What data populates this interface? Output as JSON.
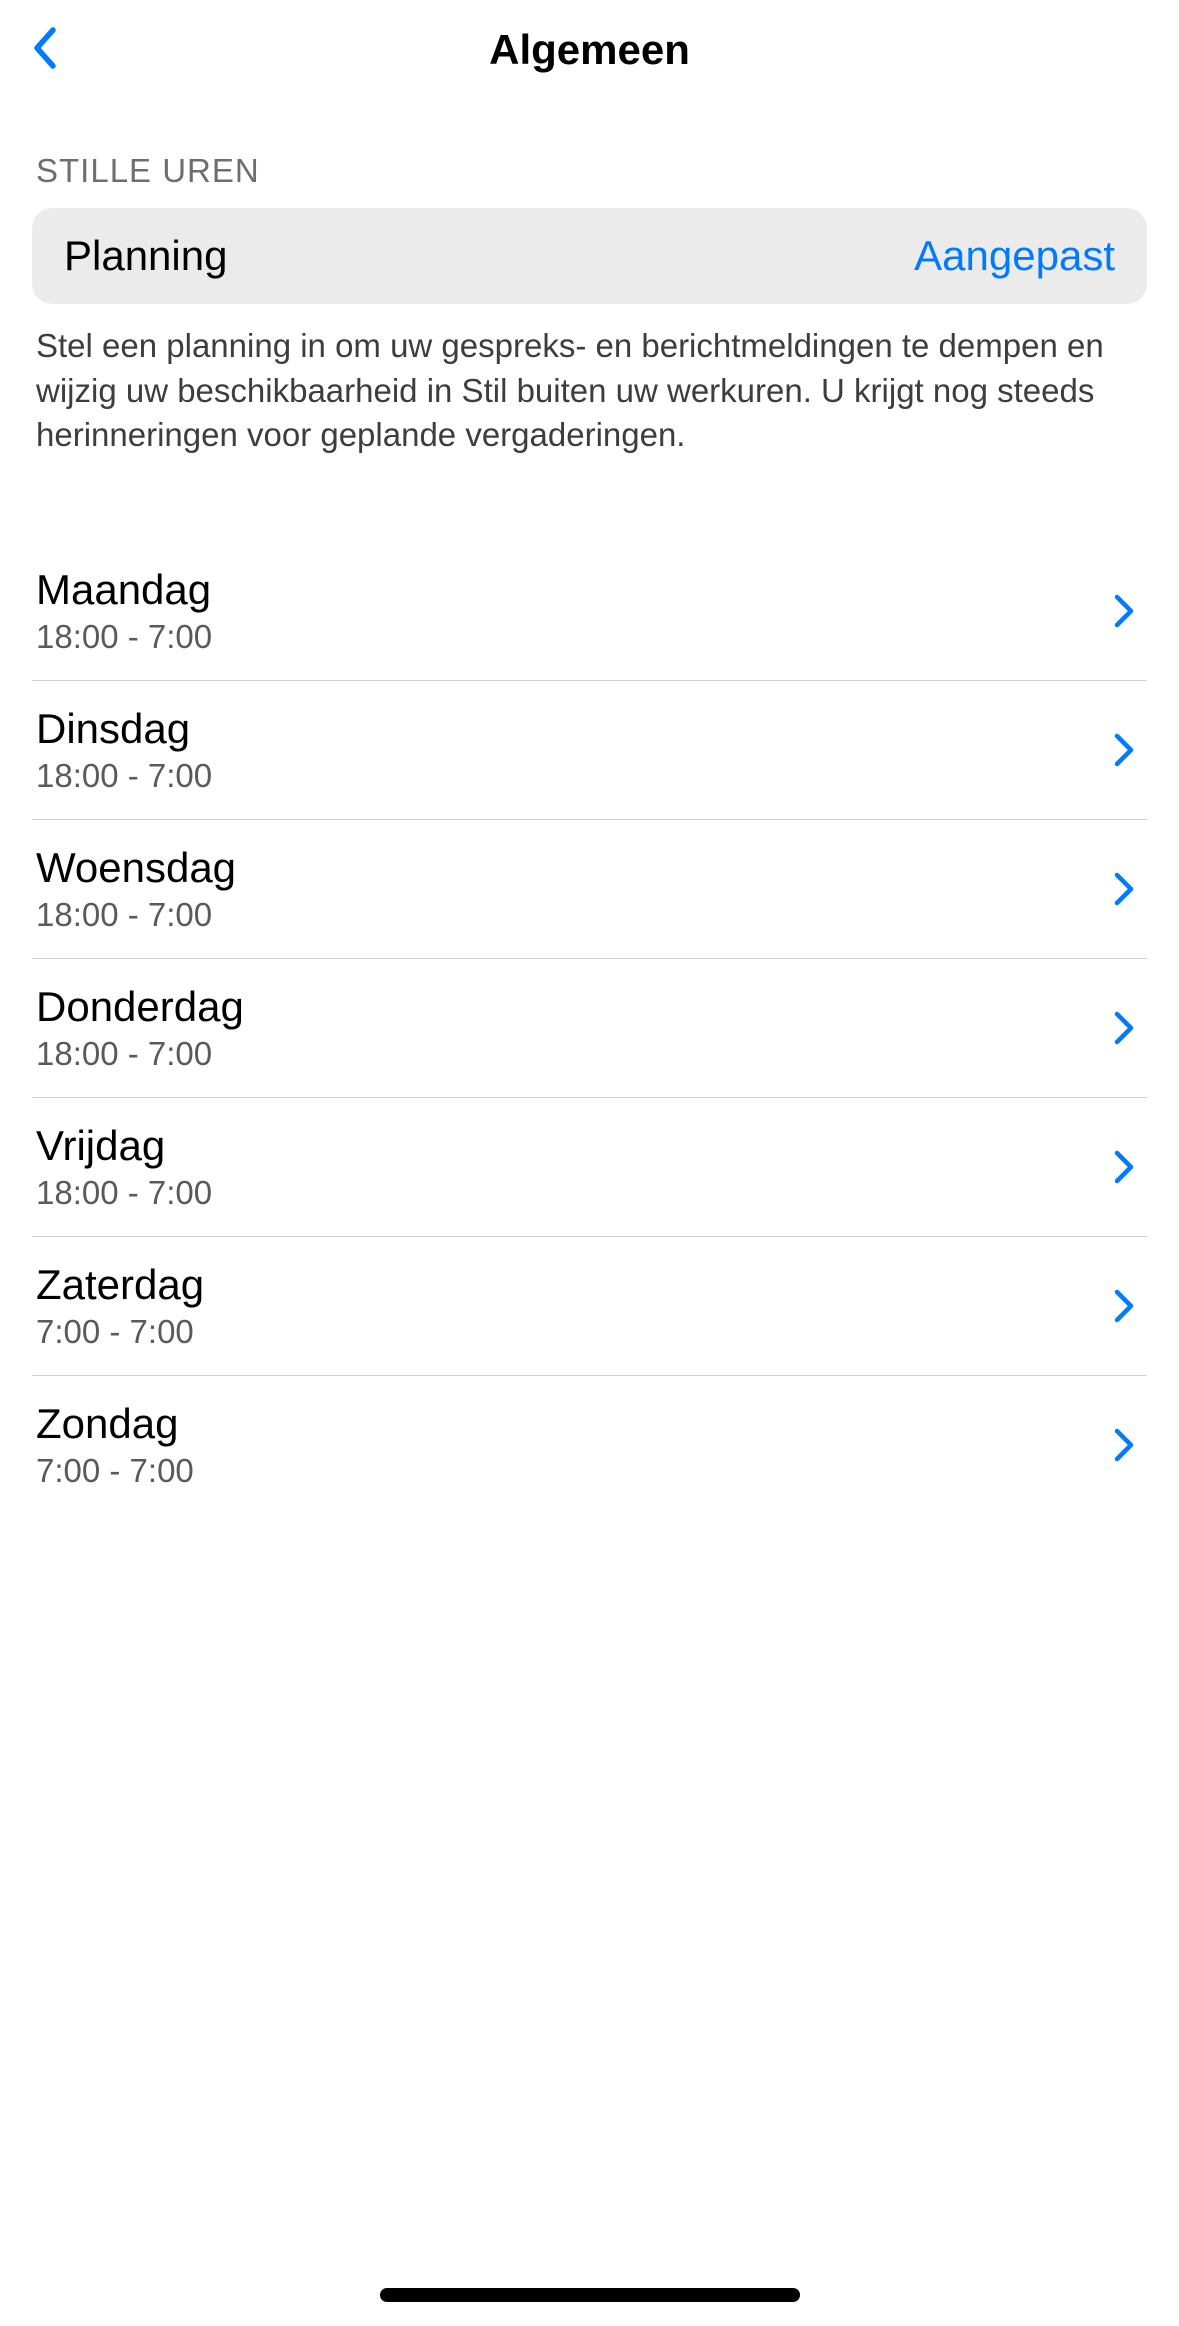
{
  "header": {
    "title": "Algemeen"
  },
  "section": {
    "header": "STILLE UREN",
    "planning": {
      "label": "Planning",
      "value": "Aangepast"
    },
    "description": "Stel een planning in om uw gespreks- en berichtmeldingen te dempen en wijzig uw beschikbaarheid in Stil buiten uw werkuren. U krijgt nog steeds herinneringen voor geplande vergaderingen."
  },
  "days": [
    {
      "name": "Maandag",
      "time": "18:00 - 7:00"
    },
    {
      "name": "Dinsdag",
      "time": "18:00 - 7:00"
    },
    {
      "name": "Woensdag",
      "time": "18:00 - 7:00"
    },
    {
      "name": "Donderdag",
      "time": "18:00 - 7:00"
    },
    {
      "name": "Vrijdag",
      "time": "18:00 - 7:00"
    },
    {
      "name": "Zaterdag",
      "time": "7:00 - 7:00"
    },
    {
      "name": "Zondag",
      "time": "7:00 - 7:00"
    }
  ]
}
